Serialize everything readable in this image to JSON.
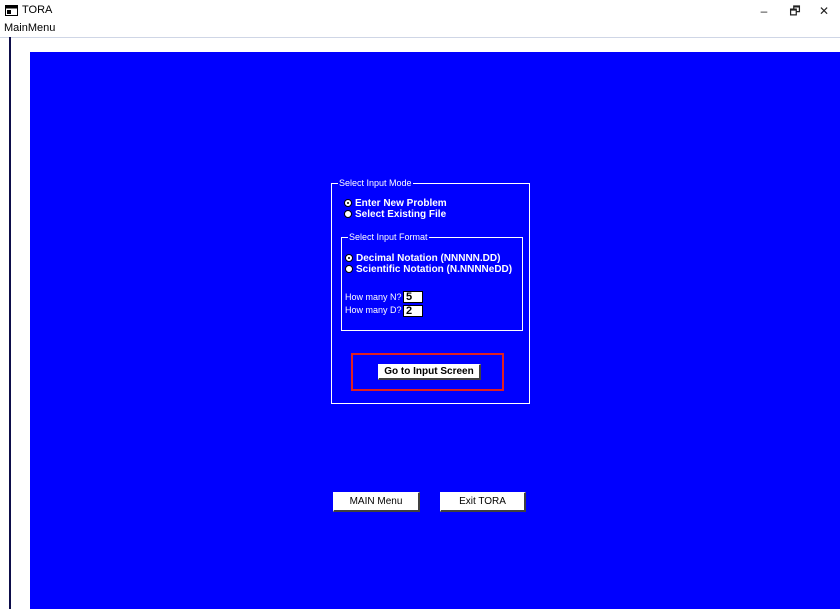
{
  "window": {
    "title": "TORA",
    "minimize": "–",
    "restore": "🗗",
    "close": "✕"
  },
  "menu": {
    "main_menu": "MainMenu"
  },
  "input_mode": {
    "group_title": "Select Input Mode",
    "options": [
      {
        "label": "Enter New Problem",
        "selected": true
      },
      {
        "label": "Select Existing File",
        "selected": false
      }
    ]
  },
  "input_format": {
    "group_title": "Select Input Format",
    "options": [
      {
        "label": "Decimal Notation (NNNNN.DD)",
        "selected": true
      },
      {
        "label": "Scientific Notation (N.NNNNeDD)",
        "selected": false
      }
    ],
    "n_label": "How many N?",
    "n_value": "5",
    "d_label": "How many D?",
    "d_value": "2"
  },
  "buttons": {
    "go_to_input": "Go to Input Screen",
    "main_menu": "MAIN Menu",
    "exit": "Exit TORA"
  },
  "colors": {
    "canvas": "#0000ff",
    "highlight": "#e02020"
  }
}
